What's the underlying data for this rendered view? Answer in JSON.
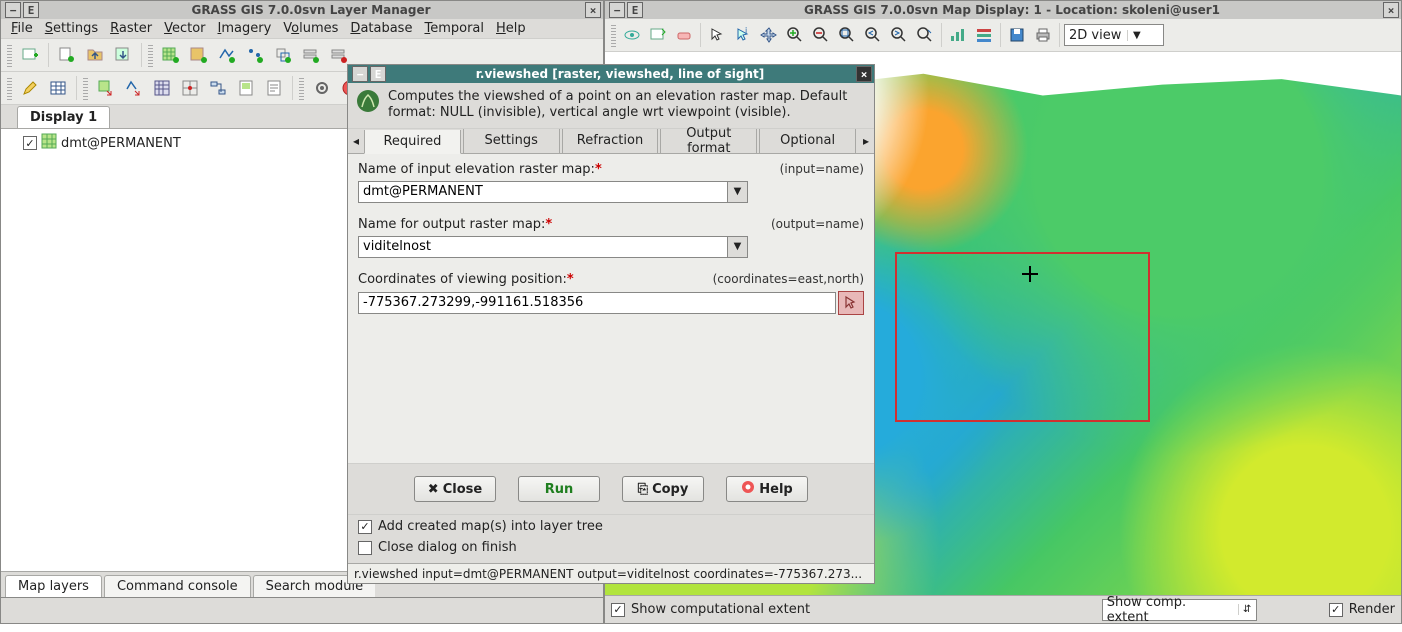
{
  "layer_manager": {
    "title": "GRASS GIS 7.0.0svn Layer Manager",
    "menus": [
      "File",
      "Settings",
      "Raster",
      "Vector",
      "Imagery",
      "Volumes",
      "Database",
      "Temporal",
      "Help"
    ],
    "display_tab": "Display 1",
    "layer": {
      "name": "dmt@PERMANENT"
    },
    "bottom_tabs": [
      "Map layers",
      "Command console",
      "Search module"
    ]
  },
  "map_display": {
    "title": "GRASS GIS 7.0.0svn Map Display: 1  - Location: skoleni@user1",
    "view_mode": "2D view",
    "status_check_label": "Show computational extent",
    "status_combo": "Show comp. extent",
    "render_label": "Render"
  },
  "dialog": {
    "title": "r.viewshed [raster, viewshed, line of sight]",
    "description": "Computes the viewshed of a point on an elevation raster map. Default format: NULL (invisible), vertical angle wrt viewpoint (visible).",
    "tabs": [
      "Required",
      "Settings",
      "Refraction",
      "Output format",
      "Optional"
    ],
    "input_label": "Name of input elevation raster map:",
    "input_hint": "(input=name)",
    "input_value": "dmt@PERMANENT",
    "output_label": "Name for output raster map:",
    "output_hint": "(output=name)",
    "output_value": "viditelnost",
    "coord_label": "Coordinates of viewing position:",
    "coord_hint": "(coordinates=east,north)",
    "coord_value": "-775367.273299,-991161.518356",
    "btn_close": "Close",
    "btn_run": "Run",
    "btn_copy": "Copy",
    "btn_help": "Help",
    "chk_addlayer": "Add created map(s) into layer tree",
    "chk_closefinish": "Close dialog on finish",
    "status": "r.viewshed input=dmt@PERMANENT output=viditelnost coordinates=-775367.273..."
  }
}
